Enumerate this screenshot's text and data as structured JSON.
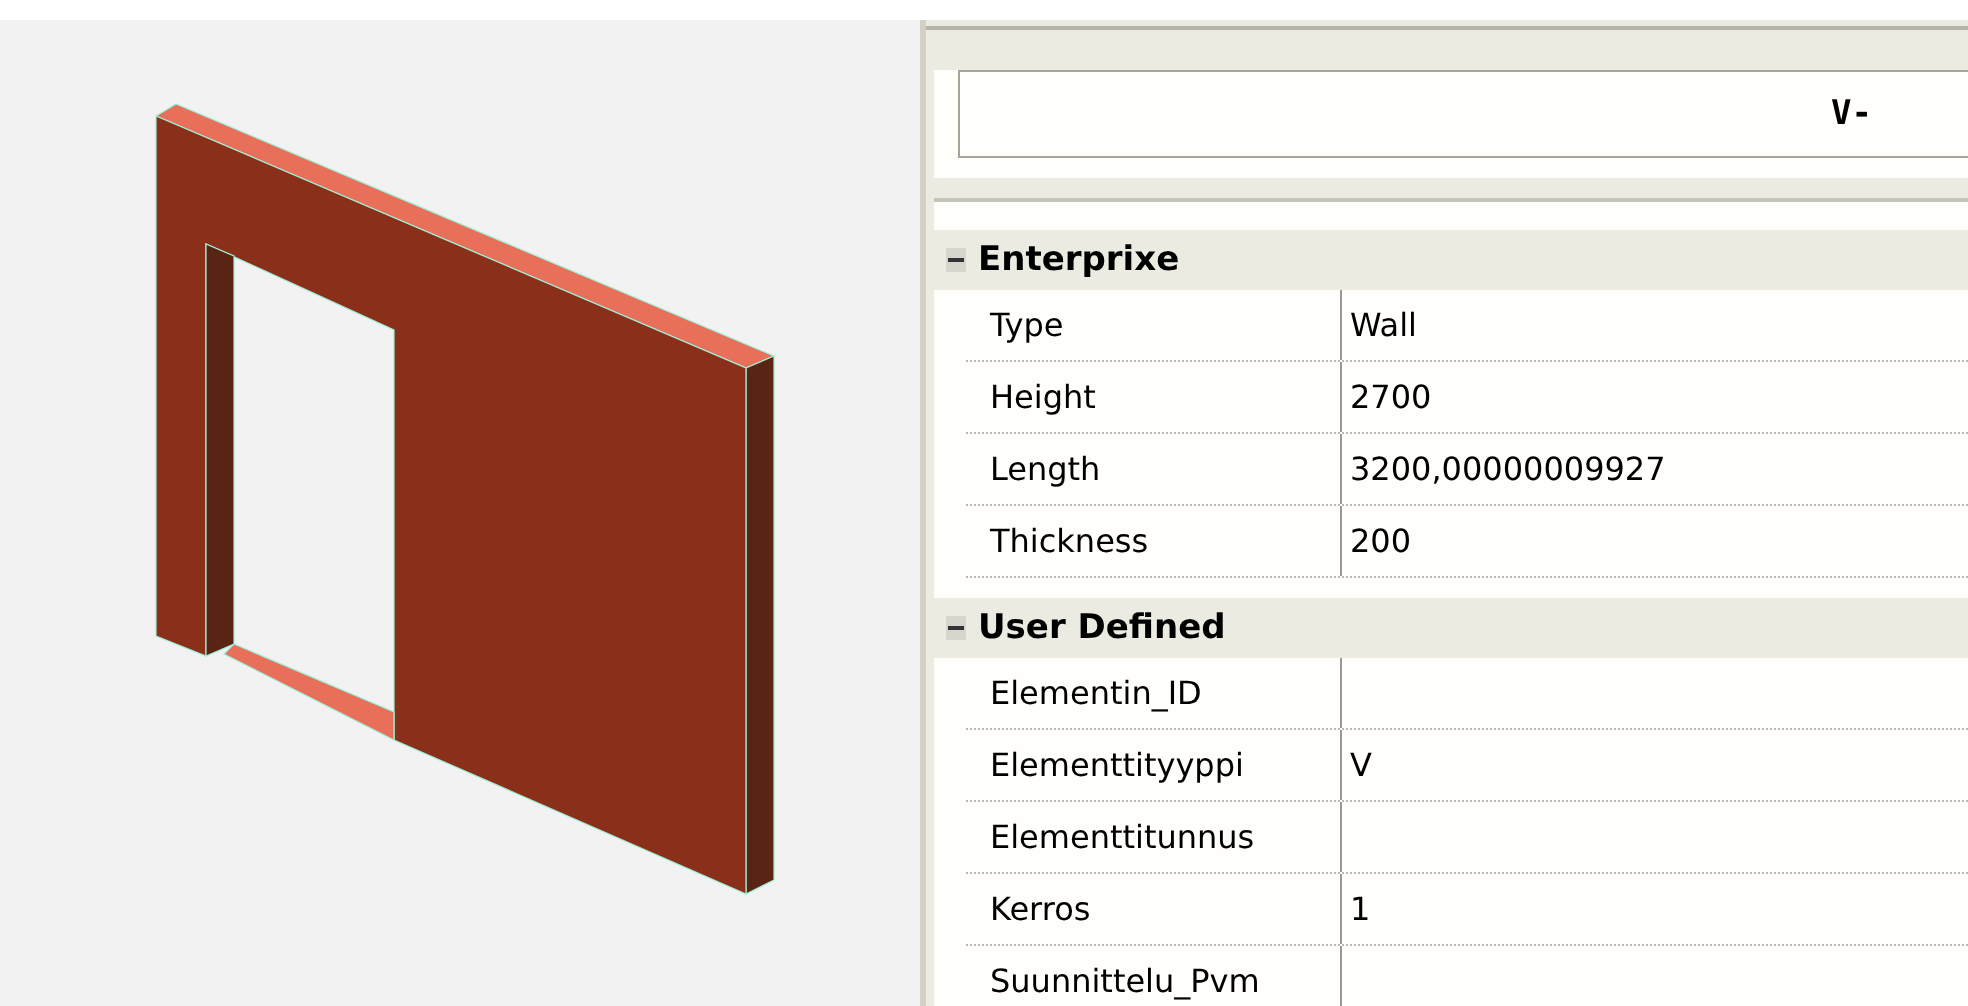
{
  "header": {
    "value": "V-"
  },
  "sections": [
    {
      "title": "Enterprixe",
      "expanded": true,
      "rows": [
        {
          "name": "Type",
          "value": "Wall"
        },
        {
          "name": "Height",
          "value": "2700"
        },
        {
          "name": "Length",
          "value": "3200,00000009927"
        },
        {
          "name": "Thickness",
          "value": "200"
        }
      ]
    },
    {
      "title": "User Defined",
      "expanded": true,
      "rows": [
        {
          "name": "Elementin_ID"
        },
        {
          "name": "Elementtityyppi",
          "value": "V"
        },
        {
          "name": "Elementtitunnus"
        },
        {
          "name": "Kerros",
          "value": "1"
        },
        {
          "name": "Suunnittelu_Pvm"
        }
      ]
    }
  ]
}
